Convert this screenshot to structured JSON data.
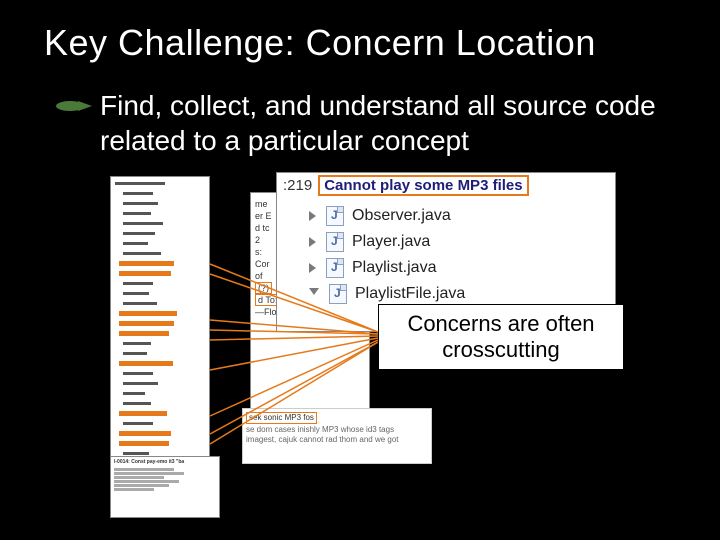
{
  "title": "Key Challenge: Concern Location",
  "bullet": "Find, collect, and understand all source code related to a particular concept",
  "bug": {
    "id": ":219",
    "title": "Cannot play some MP3 files"
  },
  "files": [
    {
      "name": "Observer.java"
    },
    {
      "name": "Player.java"
    },
    {
      "name": "Playlist.java"
    },
    {
      "name": "PlaylistFile.java"
    }
  ],
  "callout": "Concerns are often crosscutting",
  "mid_panel": {
    "lines": [
      "me",
      "er E",
      "d tc",
      "2",
      "s:",
      "Cor",
      "of",
      "s: (?)",
      "d To: (?)",
      "—Florat"
    ],
    "highlights": [
      "(?)",
      "d To: (?)"
    ]
  },
  "blur_panel": {
    "highlight": "sek sonic MP3 fos",
    "lines": [
      "se dom cases inishly MP3 whose id3 tags",
      "imagest, cajuk cannot rad thom and we got"
    ]
  },
  "bottom_panel_title": "I-0014: Const pay-emo it3 \"ba"
}
